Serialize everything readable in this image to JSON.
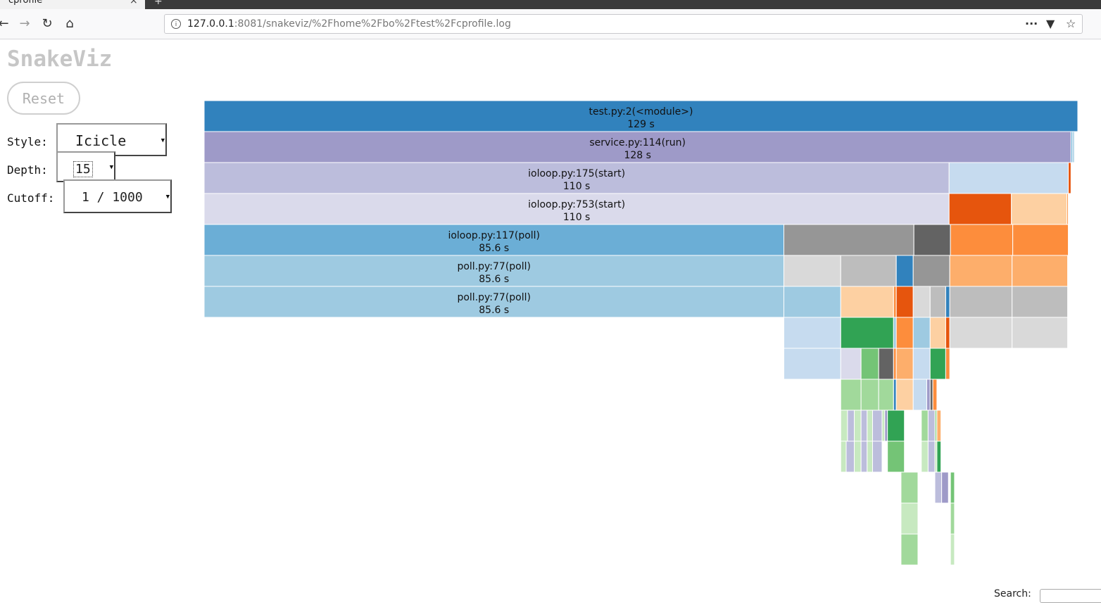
{
  "browser": {
    "tab_title": "cprofile",
    "tab_close": "×",
    "new_tab": "+",
    "url_host": "127.0.0.1",
    "url_rest": ":8081/snakeviz/%2Fhome%2Fbo%2Ftest%2Fcprofile.log",
    "nav_icons": [
      "back-icon",
      "forward-icon",
      "reload-icon",
      "home-icon"
    ],
    "url_actions": [
      "more-icon",
      "pocket-icon",
      "bookmark-star-icon"
    ]
  },
  "app": {
    "title": "SnakeViz",
    "reset_label": "Reset",
    "style_label": "Style:",
    "style_value": "Icicle",
    "depth_label": "Depth:",
    "depth_value": "15",
    "cutoff_label": "Cutoff:",
    "cutoff_value": "1 / 1000",
    "search_label": "Search:"
  },
  "icicle": {
    "root_total_s": 129,
    "rows": [
      {
        "blocks": [
          {
            "name": "test.py:2(<module>)",
            "time": "129 s",
            "value": 129,
            "color": "#3182bd"
          }
        ]
      },
      {
        "blocks": [
          {
            "name": "service.py:114(run)",
            "time": "128 s",
            "value": 128,
            "color": "#9e9ac8"
          },
          {
            "name": "",
            "time": "",
            "value": 0.25,
            "color": "#6baed6"
          },
          {
            "name": "",
            "time": "",
            "value": 0.25,
            "color": "#9ecae1"
          }
        ]
      },
      {
        "blocks": [
          {
            "name": "ioloop.py:175(start)",
            "time": "110 s",
            "value": 110,
            "color": "#bcbddc"
          },
          {
            "name": "",
            "time": "",
            "value": 17.6,
            "color": "#c6dbef"
          },
          {
            "name": "",
            "time": "",
            "value": 0.4,
            "color": "#e6550d"
          }
        ]
      },
      {
        "blocks": [
          {
            "name": "ioloop.py:753(start)",
            "time": "110 s",
            "value": 110,
            "color": "#dadaeb"
          },
          {
            "name": "",
            "time": "",
            "value": 9.2,
            "color": "#e6550d"
          },
          {
            "name": "",
            "time": "",
            "value": 8.2,
            "color": "#fdd0a2"
          },
          {
            "name": "",
            "time": "",
            "value": 0.2,
            "color": "#fd8d3c"
          }
        ]
      },
      {
        "blocks": [
          {
            "name": "ioloop.py:117(poll)",
            "time": "85.6 s",
            "value": 85.6,
            "color": "#6baed6"
          },
          {
            "name": "",
            "time": "",
            "value": 19.2,
            "color": "#969696"
          },
          {
            "name": "",
            "time": "",
            "value": 5.4,
            "color": "#636363"
          },
          {
            "name": "",
            "time": "",
            "value": 9.2,
            "color": "#fd8d3c"
          },
          {
            "name": "",
            "time": "",
            "value": 8.2,
            "color": "#fd8d3c"
          }
        ]
      },
      {
        "blocks": [
          {
            "name": "poll.py:77(poll)",
            "time": "85.6 s",
            "value": 85.6,
            "color": "#9ecae1"
          },
          {
            "name": "",
            "time": "",
            "value": 8.4,
            "color": "#d9d9d9"
          },
          {
            "name": "",
            "time": "",
            "value": 8.2,
            "color": "#bdbdbd"
          },
          {
            "name": "",
            "time": "",
            "value": 2.5,
            "color": "#3182bd"
          },
          {
            "name": "",
            "time": "",
            "value": 5.4,
            "color": "#969696"
          },
          {
            "name": "",
            "time": "",
            "value": 9.2,
            "color": "#fdae6b"
          },
          {
            "name": "",
            "time": "",
            "value": 8.2,
            "color": "#fdae6b"
          }
        ]
      },
      {
        "blocks": [
          {
            "name": "poll.py:77(poll)",
            "time": "85.6 s",
            "value": 85.6,
            "color": "#9ecae1"
          },
          {
            "name": "",
            "time": "",
            "value": 8.4,
            "color": "#9ecae1"
          },
          {
            "name": "",
            "time": "",
            "value": 7.8,
            "color": "#fdd0a2"
          },
          {
            "name": "",
            "time": "",
            "value": 0.4,
            "color": "#fd8d3c"
          },
          {
            "name": "",
            "time": "",
            "value": 2.5,
            "color": "#e6550d"
          },
          {
            "name": "",
            "time": "",
            "value": 2.5,
            "color": "#d9d9d9"
          },
          {
            "name": "",
            "time": "",
            "value": 2.3,
            "color": "#bdbdbd"
          },
          {
            "name": "",
            "time": "",
            "value": 0.6,
            "color": "#3182bd"
          },
          {
            "name": "",
            "time": "",
            "value": 9.2,
            "color": "#bdbdbd"
          },
          {
            "name": "",
            "time": "",
            "value": 8.2,
            "color": "#bdbdbd"
          }
        ]
      },
      {
        "blocks": [
          {
            "name": "",
            "time": "",
            "value": 85.6,
            "color": "none"
          },
          {
            "name": "",
            "time": "",
            "value": 8.4,
            "color": "#c6dbef"
          },
          {
            "name": "",
            "time": "",
            "value": 7.8,
            "color": "#31a354"
          },
          {
            "name": "",
            "time": "",
            "value": 0.4,
            "color": "#9ecae1"
          },
          {
            "name": "",
            "time": "",
            "value": 2.5,
            "color": "#fd8d3c"
          },
          {
            "name": "",
            "time": "",
            "value": 2.5,
            "color": "#9ecae1"
          },
          {
            "name": "",
            "time": "",
            "value": 2.3,
            "color": "#fdd0a2"
          },
          {
            "name": "",
            "time": "",
            "value": 0.6,
            "color": "#e6550d"
          },
          {
            "name": "",
            "time": "",
            "value": 9.2,
            "color": "#d9d9d9"
          },
          {
            "name": "",
            "time": "",
            "value": 8.2,
            "color": "#d9d9d9"
          }
        ]
      },
      {
        "blocks": [
          {
            "name": "",
            "time": "",
            "value": 85.6,
            "color": "none"
          },
          {
            "name": "",
            "time": "",
            "value": 8.4,
            "color": "#c6dbef"
          },
          {
            "name": "",
            "time": "",
            "value": 3.0,
            "color": "#dadaeb"
          },
          {
            "name": "",
            "time": "",
            "value": 2.6,
            "color": "#74c476"
          },
          {
            "name": "",
            "time": "",
            "value": 2.2,
            "color": "#636363"
          },
          {
            "name": "",
            "time": "",
            "value": 0.4,
            "color": "#fd8d3c"
          },
          {
            "name": "",
            "time": "",
            "value": 2.5,
            "color": "#fdae6b"
          },
          {
            "name": "",
            "time": "",
            "value": 2.5,
            "color": "#c6dbef"
          },
          {
            "name": "",
            "time": "",
            "value": 2.3,
            "color": "#31a354"
          },
          {
            "name": "",
            "time": "",
            "value": 0.6,
            "color": "#fd8d3c"
          }
        ]
      },
      {
        "blocks": [
          {
            "name": "",
            "time": "",
            "value": 94.0,
            "color": "none"
          },
          {
            "name": "",
            "time": "",
            "value": 3.0,
            "color": "#a1d99b"
          },
          {
            "name": "",
            "time": "",
            "value": 2.6,
            "color": "#a1d99b"
          },
          {
            "name": "",
            "time": "",
            "value": 2.2,
            "color": "#a1d99b"
          },
          {
            "name": "",
            "time": "",
            "value": 0.4,
            "color": "#3182bd"
          },
          {
            "name": "",
            "time": "",
            "value": 2.5,
            "color": "#fdd0a2"
          },
          {
            "name": "",
            "time": "",
            "value": 2.0,
            "color": "#c6dbef"
          },
          {
            "name": "",
            "time": "",
            "value": 0.5,
            "color": "#9e9ac8"
          },
          {
            "name": "",
            "time": "",
            "value": 0.4,
            "color": "#636363"
          },
          {
            "name": "",
            "time": "",
            "value": 0.6,
            "color": "#fd8d3c"
          }
        ]
      },
      {
        "blocks": [
          {
            "name": "",
            "time": "",
            "value": 94.0,
            "color": "none"
          },
          {
            "name": "",
            "time": "",
            "value": 1.0,
            "color": "#c7e9c0"
          },
          {
            "name": "",
            "time": "",
            "value": 1.0,
            "color": "#bcbddc"
          },
          {
            "name": "",
            "time": "",
            "value": 1.0,
            "color": "#c7e9c0"
          },
          {
            "name": "",
            "time": "",
            "value": 0.9,
            "color": "#bcbddc"
          },
          {
            "name": "",
            "time": "",
            "value": 0.8,
            "color": "#c7e9c0"
          },
          {
            "name": "",
            "time": "",
            "value": 1.4,
            "color": "#bcbddc"
          },
          {
            "name": "",
            "time": "",
            "value": 0.4,
            "color": "#c7e9c0"
          },
          {
            "name": "",
            "time": "",
            "value": 0.4,
            "color": "#9e9ac8"
          },
          {
            "name": "",
            "time": "",
            "value": 2.5,
            "color": "#31a354"
          },
          {
            "name": "",
            "time": "",
            "value": 2.5,
            "color": "none"
          },
          {
            "name": "",
            "time": "",
            "value": 1.0,
            "color": "#a1d99b"
          },
          {
            "name": "",
            "time": "",
            "value": 1.0,
            "color": "#bcbddc"
          },
          {
            "name": "",
            "time": "",
            "value": 0.3,
            "color": "#a1d99b"
          },
          {
            "name": "",
            "time": "",
            "value": 0.6,
            "color": "#fdae6b"
          }
        ]
      },
      {
        "blocks": [
          {
            "name": "",
            "time": "",
            "value": 94.0,
            "color": "none"
          },
          {
            "name": "",
            "time": "",
            "value": 0.8,
            "color": "#c7e9c0"
          },
          {
            "name": "",
            "time": "",
            "value": 1.2,
            "color": "#bcbddc"
          },
          {
            "name": "",
            "time": "",
            "value": 1.0,
            "color": "#c7e9c0"
          },
          {
            "name": "",
            "time": "",
            "value": 0.9,
            "color": "#bcbddc"
          },
          {
            "name": "",
            "time": "",
            "value": 0.8,
            "color": "#c7e9c0"
          },
          {
            "name": "",
            "time": "",
            "value": 1.4,
            "color": "#bcbddc"
          },
          {
            "name": "",
            "time": "",
            "value": 0.8,
            "color": "none"
          },
          {
            "name": "",
            "time": "",
            "value": 2.5,
            "color": "#74c476"
          },
          {
            "name": "",
            "time": "",
            "value": 2.5,
            "color": "none"
          },
          {
            "name": "",
            "time": "",
            "value": 1.0,
            "color": "#c7e9c0"
          },
          {
            "name": "",
            "time": "",
            "value": 1.0,
            "color": "#bcbddc"
          },
          {
            "name": "",
            "time": "",
            "value": 0.3,
            "color": "#c7e9c0"
          },
          {
            "name": "",
            "time": "",
            "value": 0.6,
            "color": "#31a354"
          }
        ]
      },
      {
        "blocks": [
          {
            "name": "",
            "time": "",
            "value": 102.9,
            "color": "none"
          },
          {
            "name": "",
            "time": "",
            "value": 2.5,
            "color": "#a1d99b"
          },
          {
            "name": "",
            "time": "",
            "value": 2.5,
            "color": "none"
          },
          {
            "name": "",
            "time": "",
            "value": 1.0,
            "color": "#bcbddc"
          },
          {
            "name": "",
            "time": "",
            "value": 1.0,
            "color": "#9e9ac8"
          },
          {
            "name": "",
            "time": "",
            "value": 0.3,
            "color": "none"
          },
          {
            "name": "",
            "time": "",
            "value": 0.6,
            "color": "#74c476"
          }
        ]
      },
      {
        "blocks": [
          {
            "name": "",
            "time": "",
            "value": 102.9,
            "color": "none"
          },
          {
            "name": "",
            "time": "",
            "value": 2.5,
            "color": "#c7e9c0"
          },
          {
            "name": "",
            "time": "",
            "value": 4.8,
            "color": "none"
          },
          {
            "name": "",
            "time": "",
            "value": 0.6,
            "color": "#a1d99b"
          }
        ]
      },
      {
        "blocks": [
          {
            "name": "",
            "time": "",
            "value": 102.9,
            "color": "none"
          },
          {
            "name": "",
            "time": "",
            "value": 2.5,
            "color": "#a1d99b"
          },
          {
            "name": "",
            "time": "",
            "value": 4.8,
            "color": "none"
          },
          {
            "name": "",
            "time": "",
            "value": 0.6,
            "color": "#c7e9c0"
          }
        ]
      }
    ]
  }
}
